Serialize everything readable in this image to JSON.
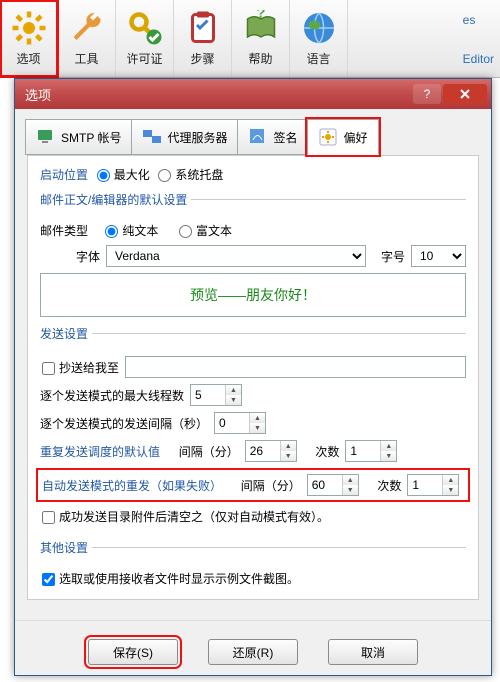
{
  "toolbar": {
    "items": [
      {
        "label": "选项"
      },
      {
        "label": "工具"
      },
      {
        "label": "许可证"
      },
      {
        "label": "步骤"
      },
      {
        "label": "帮助"
      },
      {
        "label": "语言"
      }
    ],
    "right_links": {
      "top": "es",
      "bottom": "Editor"
    }
  },
  "dialog": {
    "title": "选项",
    "tabs": {
      "smtp": "SMTP 帐号",
      "proxy": "代理服务器",
      "signature": "签名",
      "prefs": "偏好"
    },
    "start": {
      "label": "启动位置",
      "opt_max": "最大化",
      "opt_tray": "系统托盘"
    },
    "editor": {
      "legend": "邮件正文/编辑器的默认设置",
      "type_label": "邮件类型",
      "type_plain": "纯文本",
      "type_rich": "富文本",
      "font_label": "字体",
      "font_value": "Verdana",
      "size_label": "字号",
      "size_value": "10",
      "preview": "预览——朋友你好！"
    },
    "send": {
      "legend": "发送设置",
      "cc_label": "抄送给我至",
      "cc_value": "",
      "maxthreads_label": "逐个发送模式的最大线程数",
      "maxthreads_value": "5",
      "interval_label": "逐个发送模式的发送间隔（秒）",
      "interval_value": "0",
      "repeat_label": "重复发送调度的默认值",
      "repeat_interval_label": "间隔（分）",
      "repeat_interval_value": "26",
      "repeat_count_label": "次数",
      "repeat_count_value": "1",
      "auto_label": "自动发送模式的重发（如果失败）",
      "auto_interval_label": "间隔（分）",
      "auto_interval_value": "60",
      "auto_count_label": "次数",
      "auto_count_value": "1",
      "clear_label": "成功发送目录附件后清空之（仅对自动模式有效）。"
    },
    "other": {
      "legend": "其他设置",
      "thumb_label": "选取或使用接收者文件时显示示例文件截图。"
    },
    "buttons": {
      "save": "保存(S)",
      "restore": "还原(R)",
      "cancel": "取消"
    }
  }
}
